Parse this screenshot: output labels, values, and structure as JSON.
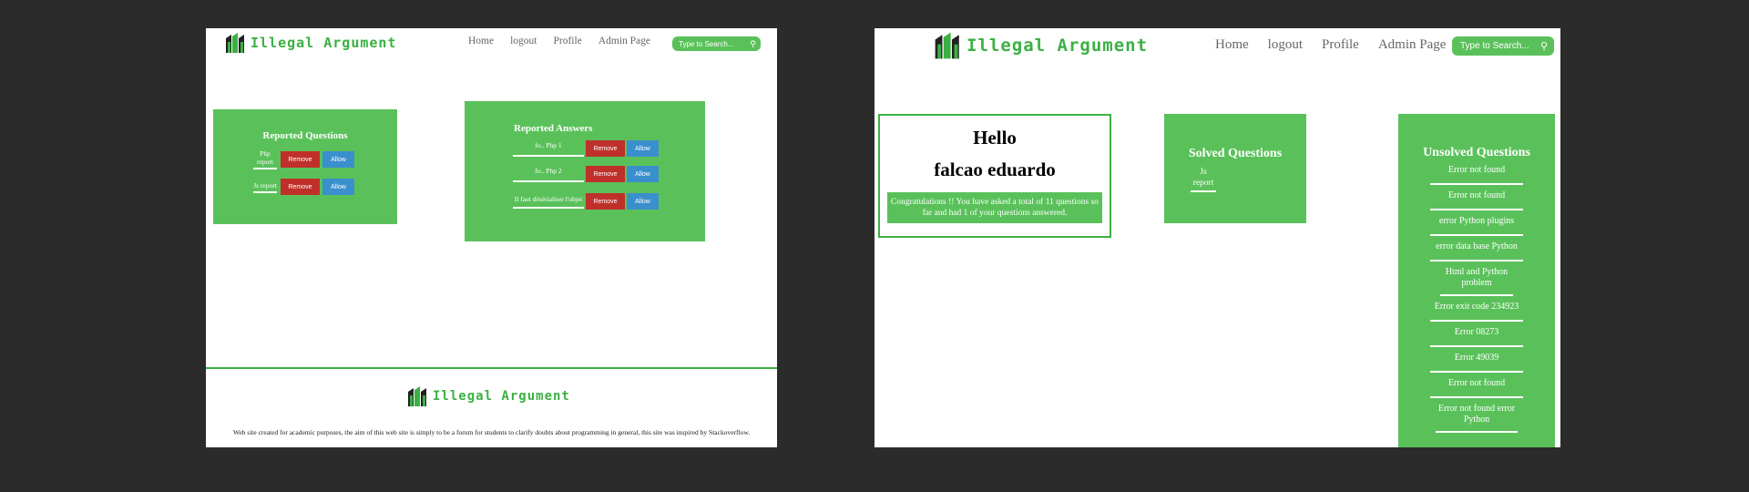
{
  "site": {
    "name": "Illegal Argument"
  },
  "left": {
    "nav": [
      "Home",
      "logout",
      "Profile",
      "Admin Page"
    ],
    "search": {
      "placeholder": "Type to Search..."
    },
    "reported_questions": {
      "title": "Reported Questions",
      "items": [
        {
          "label": "Php report",
          "remove": "Remove",
          "allow": "Allow"
        },
        {
          "label": "Js report",
          "remove": "Remove",
          "allow": "Allow"
        }
      ]
    },
    "reported_answers": {
      "title": "Reported Answers",
      "items": [
        {
          "label": "fo.. Php 1",
          "remove": "Remove",
          "allow": "Allow"
        },
        {
          "label": "fo.. Php 2",
          "remove": "Remove",
          "allow": "Allow"
        },
        {
          "label": "Il faut désérialiser l'objet",
          "remove": "Remove",
          "allow": "Allow"
        }
      ]
    },
    "footer": {
      "text": "Web site created for academic purposes, the aim of this web site is simply to be a forum for students to clarify doubts about programming in general, this site was inspired by Stackoverflow."
    }
  },
  "right": {
    "nav": [
      "Home",
      "logout",
      "Profile",
      "Admin Page"
    ],
    "search": {
      "placeholder": "Type to Search..."
    },
    "hello": {
      "greeting": "Hello",
      "name": "falcao eduardo",
      "congrats": "Congratulations !! You have asked a total of 11 questions so far and had 1 of your questions answered."
    },
    "solved": {
      "title": "Solved Questions",
      "items": [
        "Js report"
      ]
    },
    "unsolved": {
      "title": "Unsolved Questions",
      "items": [
        "Error not found",
        "Error not found",
        "error Python plugins",
        "error data base Python",
        "Html and Python problem",
        "Error exit code 234923",
        "Error 08273",
        "Error 49039",
        "Error not found",
        "Error not found error Python"
      ]
    }
  },
  "colors": {
    "green": "#5ac15a",
    "logo_green": "#3cb043",
    "remove_red": "#c0302a",
    "allow_blue": "#3a8fcd",
    "backdrop": "#2b2b2b"
  }
}
